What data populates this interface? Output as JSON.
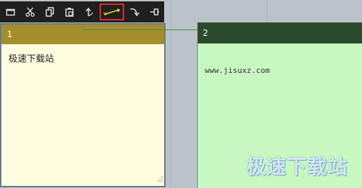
{
  "toolbar": {
    "buttons": [
      {
        "icon": "new-note-icon"
      },
      {
        "icon": "cut-icon"
      },
      {
        "icon": "copy-icon"
      },
      {
        "icon": "paste-icon"
      },
      {
        "icon": "arrow-up-icon"
      },
      {
        "icon": "link-icon",
        "active": true
      },
      {
        "icon": "arrow-curve-down-icon"
      },
      {
        "icon": "pin-icon"
      }
    ],
    "active_outline_color": "#e02b2b"
  },
  "note1": {
    "number": "1",
    "text": "极速下载站",
    "header_color": "#a58d2c",
    "body_color": "#fffde0"
  },
  "note2": {
    "number": "2",
    "text": "www.jisuxz.com",
    "header_color": "#2b4a2d",
    "body_color": "#c9f7c2"
  },
  "watermark": "极速下载站"
}
